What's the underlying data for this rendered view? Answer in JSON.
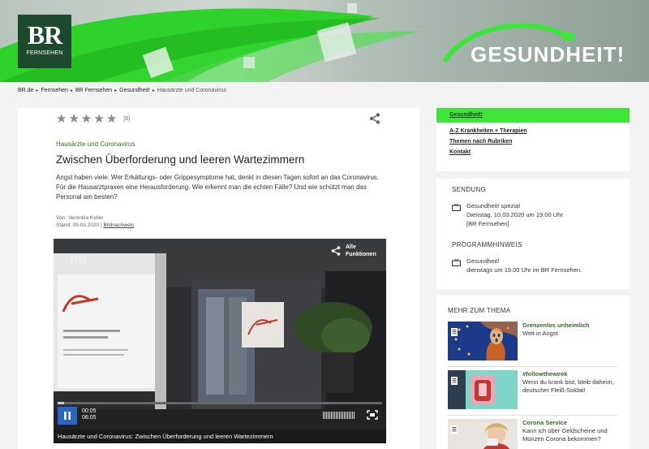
{
  "header": {
    "logo_main": "BR",
    "logo_sub": "FERNSEHEN",
    "brand_title": "GESUNDHEIT!"
  },
  "breadcrumb": {
    "items": [
      "BR.de",
      "Fernsehen",
      "BR Fernsehen",
      "Gesundheit!"
    ],
    "current": "Hausärzte und Coronavirus"
  },
  "article": {
    "rating_count": "[6]",
    "kicker": "Hausärzte und Coronavirus",
    "headline": "Zwischen Überforderung und leeren Wartezimmern",
    "teaser": "Angst haben viele: Wer Erkältungs- oder Grippesymptome hat, denkt in diesen Tagen sofort an das Coronavirus. Für die Hausarztpraxen eine Herausforderung. Wie erkennt man die echten Fälle? Und wie schützt man das Personal am besten?",
    "author": "Von: Veronika Keller",
    "date_label": "Stand: 09.03.2020",
    "image_credit_link": "Bildnachweis"
  },
  "video": {
    "all_functions": "Alle Funktionen",
    "watermark": "BR",
    "current_time": "00:05",
    "duration": "06:05",
    "progress": 0.02,
    "caption": "Hausärzte und Coronavirus: Zwischen Überforderung und leeren Wartezimmern"
  },
  "sidebar_nav": {
    "active": "Gesundheit!",
    "items": [
      "A-Z Krankheiten + Therapien",
      "Themen nach Rubriken",
      "Kontakt"
    ]
  },
  "broadcast": {
    "sendung_heading": "SENDUNG",
    "sendung_title": "Gesundheit! spezial",
    "sendung_time": "Dienstag, 10.03.2020 um 19:00 Uhr",
    "sendung_channel": "[BR Fernsehen]",
    "programm_heading": "PROGRAMMHINWEIS",
    "programm_title": "Gesundheit!",
    "programm_time": "dienstags um 19.00 Uhr im BR Fernsehen."
  },
  "more": {
    "heading": "MEHR ZUM THEMA",
    "cards": [
      {
        "title": "Grenzenlos unheimlich",
        "desc": "Welt in Angst"
      },
      {
        "title": "#followtheweek",
        "desc": "Wenn du krank bist, bleib daheim, deutscher Fleiß-Soldat!"
      },
      {
        "title": "Corona Service",
        "desc": "Kann ich über Geldscheine und Münzen Corona bekommen?"
      }
    ]
  },
  "colors": {
    "accent_green": "#3ee63a",
    "logo_green": "#1d4a2d",
    "kicker_green": "#3a6a2a",
    "play_blue": "#2a66c4"
  }
}
